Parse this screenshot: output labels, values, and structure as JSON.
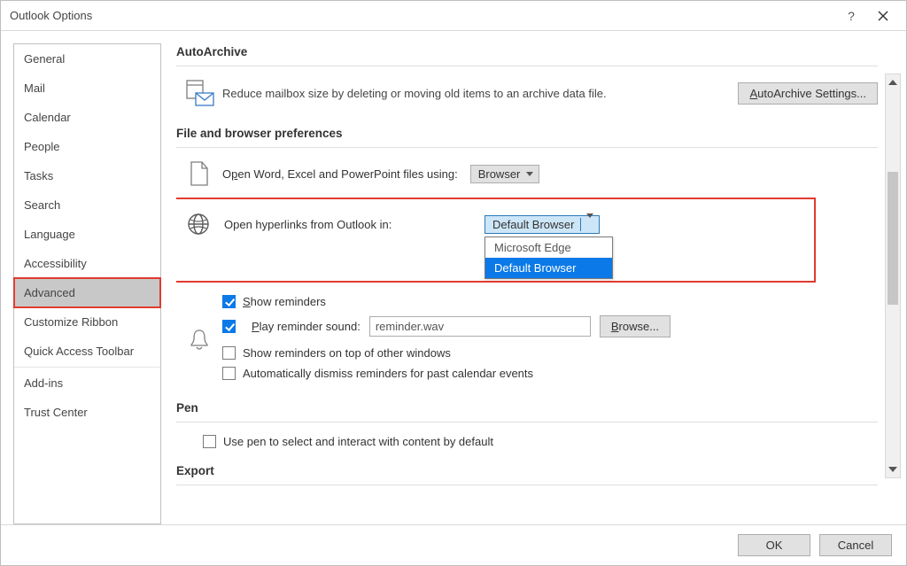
{
  "window": {
    "title": "Outlook Options",
    "help": "?",
    "close": "×"
  },
  "sidebar": {
    "items": [
      "General",
      "Mail",
      "Calendar",
      "People",
      "Tasks",
      "Search",
      "Language",
      "Accessibility",
      "Advanced",
      "Customize Ribbon",
      "Quick Access Toolbar",
      "Add-ins",
      "Trust Center"
    ],
    "selected": "Advanced"
  },
  "sections": {
    "autoarchive": {
      "title": "AutoArchive",
      "desc": "Reduce mailbox size by deleting or moving old items to an archive data file.",
      "button": "AutoArchive Settings..."
    },
    "filebrowser": {
      "title": "File and browser preferences",
      "open_files_label": "Open Word, Excel and PowerPoint files using:",
      "open_files_value": "Browser",
      "open_links_label": "Open hyperlinks from Outlook in:",
      "open_links_value": "Default Browser",
      "dropdown_items": [
        "Microsoft Edge",
        "Default Browser"
      ]
    },
    "reminders": {
      "show_reminders": "Show reminders",
      "play_sound": "Play reminder sound:",
      "sound_file": "reminder.wav",
      "browse": "Browse...",
      "on_top": "Show reminders on top of other windows",
      "auto_dismiss": "Automatically dismiss reminders for past calendar events"
    },
    "pen": {
      "title": "Pen",
      "use_pen": "Use pen to select and interact with content by default"
    },
    "export": {
      "title": "Export"
    }
  },
  "footer": {
    "ok": "OK",
    "cancel": "Cancel"
  }
}
